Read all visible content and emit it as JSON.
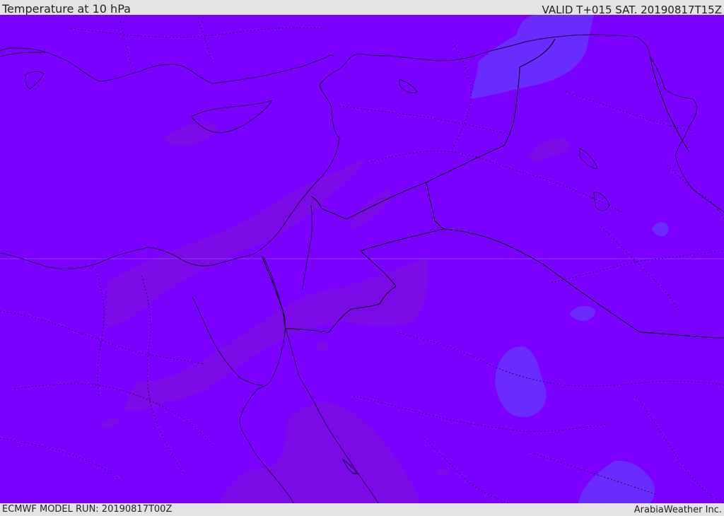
{
  "header": {
    "title": "Temperature at 10 hPa",
    "valid_time": "VALID T+015 SAT. 20190817T15Z"
  },
  "footer": {
    "model_run": "ECMWF MODEL RUN: 20190817T00Z",
    "credit": "ArabiaWeather Inc."
  },
  "colors": {
    "base_field": "#7b00ff",
    "warm_field": "#7a0ae6",
    "cool_field": "#6a2bff",
    "lines": "#1a0040"
  }
}
